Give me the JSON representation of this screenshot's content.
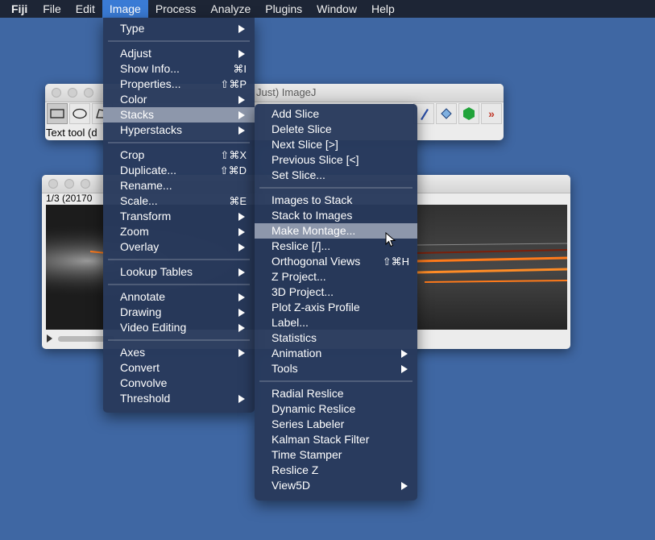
{
  "menubar": {
    "app": "Fiji",
    "items": [
      "File",
      "Edit",
      "Image",
      "Process",
      "Analyze",
      "Plugins",
      "Window",
      "Help"
    ]
  },
  "imagej_window": {
    "title": "Just) ImageJ",
    "status": "Text tool (d"
  },
  "image_window": {
    "info": "1/3 (20170"
  },
  "image_menu": {
    "items": [
      {
        "label": "Type",
        "submenu": true
      },
      {
        "label": "Adjust",
        "submenu": true
      },
      {
        "label": "Show Info...",
        "shortcut": "⌘I"
      },
      {
        "label": "Properties...",
        "shortcut": "⇧⌘P"
      },
      {
        "label": "Color",
        "submenu": true
      },
      {
        "label": "Stacks",
        "submenu": true
      },
      {
        "label": "Hyperstacks",
        "submenu": true
      },
      {
        "label": "Crop",
        "shortcut": "⇧⌘X"
      },
      {
        "label": "Duplicate...",
        "shortcut": "⇧⌘D"
      },
      {
        "label": "Rename..."
      },
      {
        "label": "Scale...",
        "shortcut": "⌘E"
      },
      {
        "label": "Transform",
        "submenu": true
      },
      {
        "label": "Zoom",
        "submenu": true
      },
      {
        "label": "Overlay",
        "submenu": true
      },
      {
        "label": "Lookup Tables",
        "submenu": true
      },
      {
        "label": "Annotate",
        "submenu": true
      },
      {
        "label": "Drawing",
        "submenu": true
      },
      {
        "label": "Video Editing",
        "submenu": true
      },
      {
        "label": "Axes",
        "submenu": true
      },
      {
        "label": "Convert"
      },
      {
        "label": "Convolve"
      },
      {
        "label": "Threshold",
        "submenu": true
      }
    ]
  },
  "stacks_menu": {
    "items": [
      {
        "label": "Add Slice"
      },
      {
        "label": "Delete Slice"
      },
      {
        "label": "Next Slice [>]"
      },
      {
        "label": "Previous Slice [<]"
      },
      {
        "label": "Set Slice..."
      },
      {
        "label": "Images to Stack"
      },
      {
        "label": "Stack to Images"
      },
      {
        "label": "Make Montage..."
      },
      {
        "label": "Reslice [/]..."
      },
      {
        "label": "Orthogonal Views",
        "shortcut": "⇧⌘H"
      },
      {
        "label": "Z Project..."
      },
      {
        "label": "3D Project..."
      },
      {
        "label": "Plot Z-axis Profile"
      },
      {
        "label": "Label..."
      },
      {
        "label": "Statistics"
      },
      {
        "label": "Animation",
        "submenu": true
      },
      {
        "label": "Tools",
        "submenu": true
      },
      {
        "label": "Radial Reslice"
      },
      {
        "label": "Dynamic Reslice"
      },
      {
        "label": "Series Labeler"
      },
      {
        "label": "Kalman Stack Filter"
      },
      {
        "label": "Time Stamper"
      },
      {
        "label": "Reslice Z"
      },
      {
        "label": "View5D",
        "submenu": true
      }
    ]
  },
  "icons": [
    "rectangle-tool-icon",
    "oval-tool-icon",
    "polygon-tool-icon",
    "pencil-tool-icon",
    "flood-fill-tool-icon",
    "lut-tool-icon",
    "more-tools-icon",
    "mouse-cursor-icon"
  ]
}
